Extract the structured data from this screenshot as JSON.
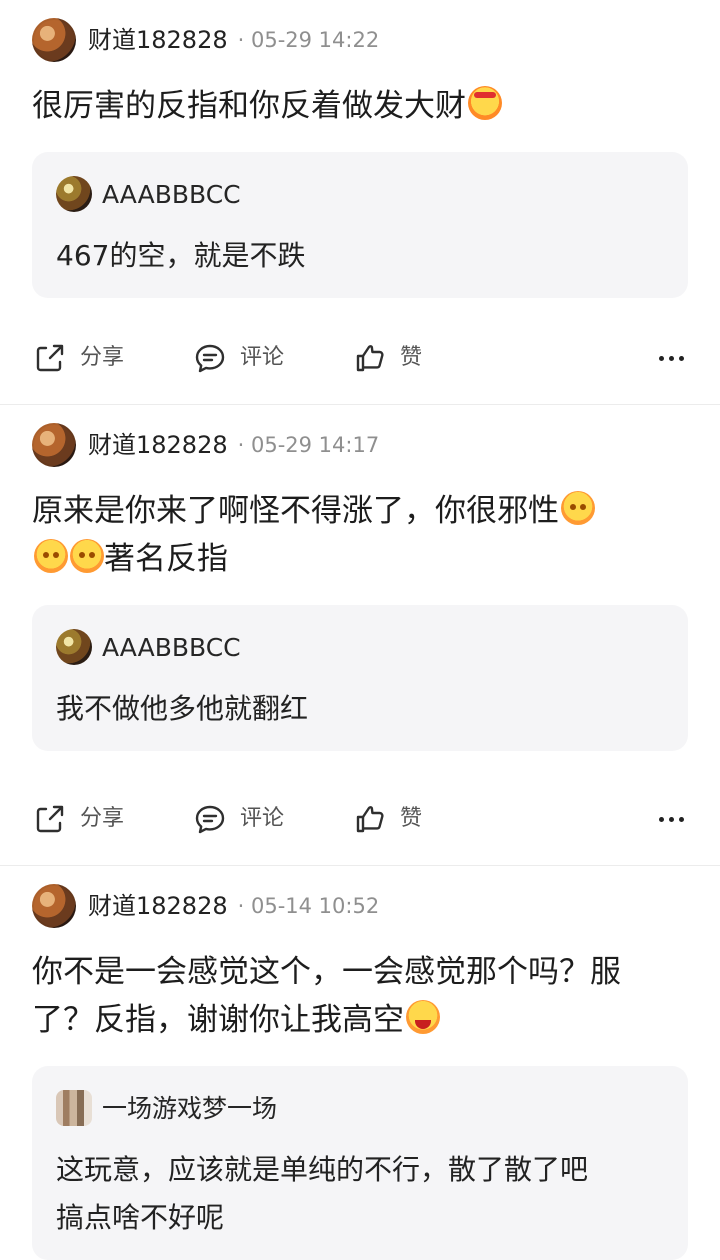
{
  "posts": [
    {
      "username": "财道182828",
      "timestamp": "· 05-29 14:22",
      "text_lines": [
        "很厉害的反指和你反着做发大财"
      ],
      "emoji": [
        "angry-face-emoji"
      ],
      "quote": {
        "username": "AAABBBCC",
        "text": "467的空，就是不跌"
      },
      "actions": {
        "share": "分享",
        "comment": "评论",
        "like": "赞"
      }
    },
    {
      "username": "财道182828",
      "timestamp": "· 05-29 14:17",
      "text_lines": [
        "原来是你来了啊怪不得涨了，你很邪性",
        "著名反指"
      ],
      "emoji": [
        "smile-face-emoji",
        "smile-face-emoji",
        "smile-face-emoji"
      ],
      "quote": {
        "username": "AAABBBCC",
        "text": "我不做他多他就翻红"
      },
      "actions": {
        "share": "分享",
        "comment": "评论",
        "like": "赞"
      }
    },
    {
      "username": "财道182828",
      "timestamp": "· 05-14 10:52",
      "text_lines": [
        "你不是一会感觉这个，一会感觉那个吗？服",
        "了？反指，谢谢你让我高空"
      ],
      "emoji": [
        "joy-face-emoji"
      ],
      "quote": {
        "username": "一场游戏梦一场",
        "text_lines": [
          "这玩意，应该就是单纯的不行，散了散了吧",
          "搞点啥不好呢"
        ]
      }
    }
  ],
  "icons": {
    "share": "share-icon",
    "comment": "comment-icon",
    "like": "thumb-up-icon",
    "more": "more-dots-icon"
  }
}
